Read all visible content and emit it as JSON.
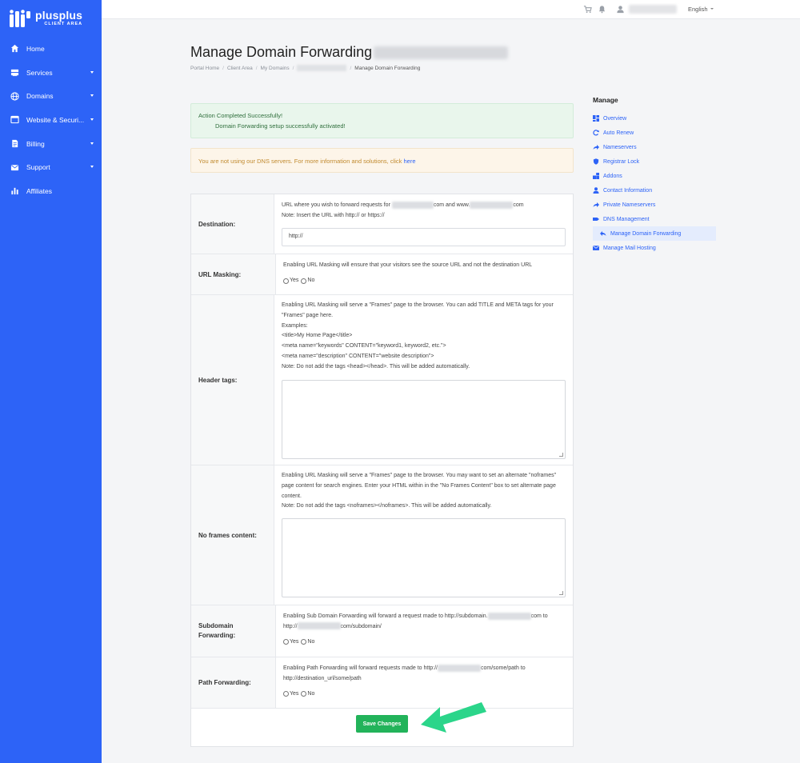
{
  "brand": {
    "name": "plusplus",
    "sub": "CLIENT AREA"
  },
  "sidebar": {
    "items": [
      {
        "label": "Home",
        "icon": "home-icon",
        "has_caret": false
      },
      {
        "label": "Services",
        "icon": "server-icon",
        "has_caret": true
      },
      {
        "label": "Domains",
        "icon": "globe-icon",
        "has_caret": true
      },
      {
        "label": "Website & Securi...",
        "icon": "window-icon",
        "has_caret": true
      },
      {
        "label": "Billing",
        "icon": "document-icon",
        "has_caret": true
      },
      {
        "label": "Support",
        "icon": "mail-icon",
        "has_caret": true
      },
      {
        "label": "Affiliates",
        "icon": "bar-chart-icon",
        "has_caret": false
      }
    ]
  },
  "topbar": {
    "language": "English"
  },
  "header": {
    "title": "Manage Domain Forwarding",
    "breadcrumb": [
      "Portal Home",
      "Client Area",
      "My Domains",
      "Manage Domain Forwarding"
    ]
  },
  "alerts": {
    "success_title": "Action Completed Successfully!",
    "success_msg": "Domain Forwarding setup successfully activated!",
    "warn_text": "You are not using our DNS servers. For more information and solutions, click ",
    "warn_link": "here"
  },
  "form": {
    "destination": {
      "label": "Destination:",
      "line1_a": "URL where you wish to forward requests for",
      "line1_b": "com and www.",
      "line1_c": "com",
      "line2": "Note: Insert the URL with http:// or https://",
      "value": "http://"
    },
    "masking": {
      "label": "URL Masking:",
      "text": "Enabling URL Masking will ensure that your visitors see the source URL and not the destination URL",
      "yes": "Yes",
      "no": "No"
    },
    "header_tags": {
      "label": "Header tags:",
      "line1": "Enabling URL Masking will serve a \"Frames\" page to the browser. You can add TITLE and META tags for your \"Frames\" page here.",
      "line2": "Examples:",
      "line3": "<title>My Home Page</title>",
      "line4": "<meta name=\"keywords\" CONTENT=\"keyword1, keyword2, etc.\">",
      "line5": "<meta name=\"description\" CONTENT=\"website description\">",
      "line6": "Note: Do not add the tags <head></head>. This will be added automatically."
    },
    "noframes": {
      "label": "No frames content:",
      "line1": "Enabling URL Masking will serve a \"Frames\" page to the browser. You may want to set an alternate \"noframes\" page content for search engines. Enter your HTML within in the \"No Frames Content\" box to set alternate page content.",
      "line2": "Note: Do not add the tags <noframes></noframes>. This will be added automatically."
    },
    "subdomain": {
      "label": "Subdomain Forwarding:",
      "text_a": "Enabling Sub Domain Forwarding will forward a request made to http://subdomain.",
      "text_b": "com to",
      "text_c": "http://",
      "text_d": "com/subdomain/",
      "yes": "Yes",
      "no": "No"
    },
    "path": {
      "label": "Path Forwarding:",
      "text_a": "Enabling Path Forwarding will forward requests made to http://",
      "text_b": "com/some/path to",
      "text_c": "http://destination_url/some/path",
      "yes": "Yes",
      "no": "No"
    },
    "save_label": "Save Changes"
  },
  "manage": {
    "title": "Manage",
    "items": [
      {
        "label": "Overview",
        "icon": "grid-icon"
      },
      {
        "label": "Auto Renew",
        "icon": "refresh-icon"
      },
      {
        "label": "Nameservers",
        "icon": "forward-arrow-icon"
      },
      {
        "label": "Registrar Lock",
        "icon": "shield-icon"
      },
      {
        "label": "Addons",
        "icon": "cubes-icon"
      },
      {
        "label": "Contact Information",
        "icon": "user-icon"
      },
      {
        "label": "Private Nameservers",
        "icon": "forward-arrow-icon"
      },
      {
        "label": "DNS Management",
        "icon": "tag-icon"
      },
      {
        "label": "Manage Domain Forwarding",
        "icon": "reply-icon",
        "active": true
      },
      {
        "label": "Manage Mail Hosting",
        "icon": "envelope-icon"
      }
    ]
  },
  "colors": {
    "brand": "#2d63f7",
    "success": "#22b35a",
    "annotation_arrow": "#2bd58a"
  }
}
